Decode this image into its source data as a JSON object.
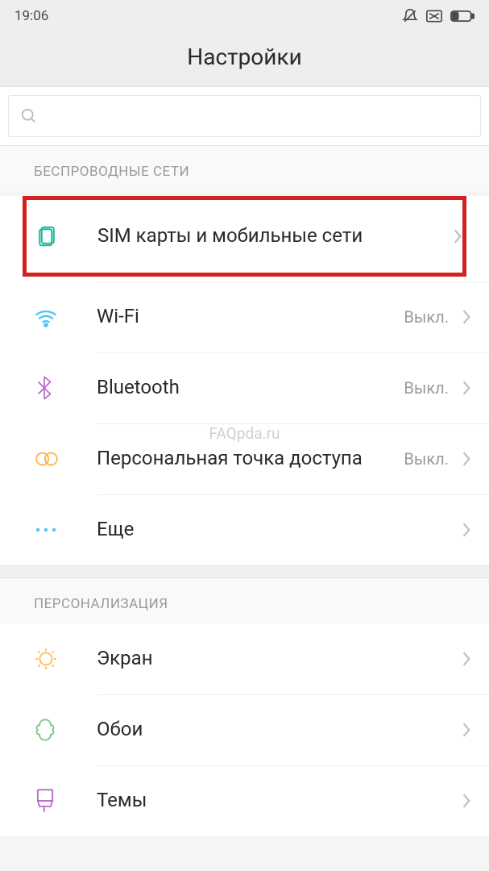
{
  "status": {
    "time": "19:06"
  },
  "header": {
    "title": "Настройки"
  },
  "sections": {
    "wireless": {
      "title": "БЕСПРОВОДНЫЕ СЕТИ",
      "items": [
        {
          "label": "SIM карты и мобильные сети",
          "status": ""
        },
        {
          "label": "Wi-Fi",
          "status": "Выкл."
        },
        {
          "label": "Bluetooth",
          "status": "Выкл."
        },
        {
          "label": "Персональная точка доступа",
          "status": "Выкл."
        },
        {
          "label": "Еще",
          "status": ""
        }
      ]
    },
    "personalization": {
      "title": "ПЕРСОНАЛИЗАЦИЯ",
      "items": [
        {
          "label": "Экран",
          "status": ""
        },
        {
          "label": "Обои",
          "status": ""
        },
        {
          "label": "Темы",
          "status": ""
        }
      ]
    }
  },
  "watermark": "FAQpda.ru"
}
